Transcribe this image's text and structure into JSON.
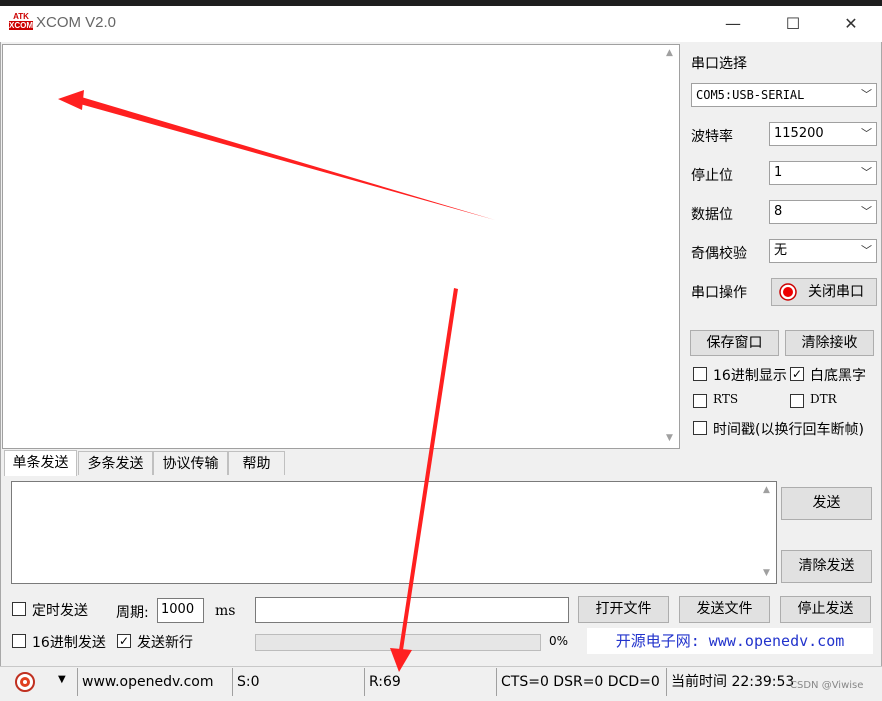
{
  "window": {
    "title": "XCOM V2.0",
    "logo_top": "ATK",
    "logo_bottom": "XCOM",
    "minimize": "—",
    "maximize": "☐",
    "close": "✕"
  },
  "settings": {
    "port_section_label": "串口选择",
    "port_value": "COM5:USB-SERIAL",
    "baud_label": "波特率",
    "baud_value": "115200",
    "stopbits_label": "停止位",
    "stopbits_value": "1",
    "databits_label": "数据位",
    "databits_value": "8",
    "parity_label": "奇偶校验",
    "parity_value": "无",
    "port_op_label": "串口操作",
    "port_op_button": "关闭串口",
    "save_window": "保存窗口",
    "clear_receive": "清除接收",
    "hex_display": "16进制显示",
    "hex_display_checked": false,
    "white_bg": "白底黑字",
    "white_bg_checked": true,
    "rts": "RTS",
    "rts_checked": false,
    "dtr": "DTR",
    "dtr_checked": false,
    "timestamp": "时间戳(以换行回车断帧)",
    "timestamp_checked": false
  },
  "tabs": [
    "单条发送",
    "多条发送",
    "协议传输",
    "帮助"
  ],
  "send": {
    "send_button": "发送",
    "clear_send_button": "清除发送",
    "timed_send": "定时发送",
    "timed_send_checked": false,
    "period_label": "周期:",
    "period_value": "1000",
    "period_unit": "ms",
    "open_file": "打开文件",
    "send_file": "发送文件",
    "stop_send": "停止发送",
    "hex_send": "16进制发送",
    "hex_send_checked": false,
    "newline": "发送新行",
    "newline_checked": true,
    "progress_text": "0%",
    "progress": 0,
    "website_banner": "开源电子网: www.openedv.com"
  },
  "status": {
    "url": "www.openedv.com",
    "sent": "S:0",
    "received": "R:69",
    "lines": "CTS=0 DSR=0 DCD=0",
    "time": "当前时间 22:39:53"
  },
  "overlay": {
    "watermark": "CSDN @Viwise"
  },
  "colors": {
    "arrow": "#ff2020",
    "link": "#2233cc"
  }
}
